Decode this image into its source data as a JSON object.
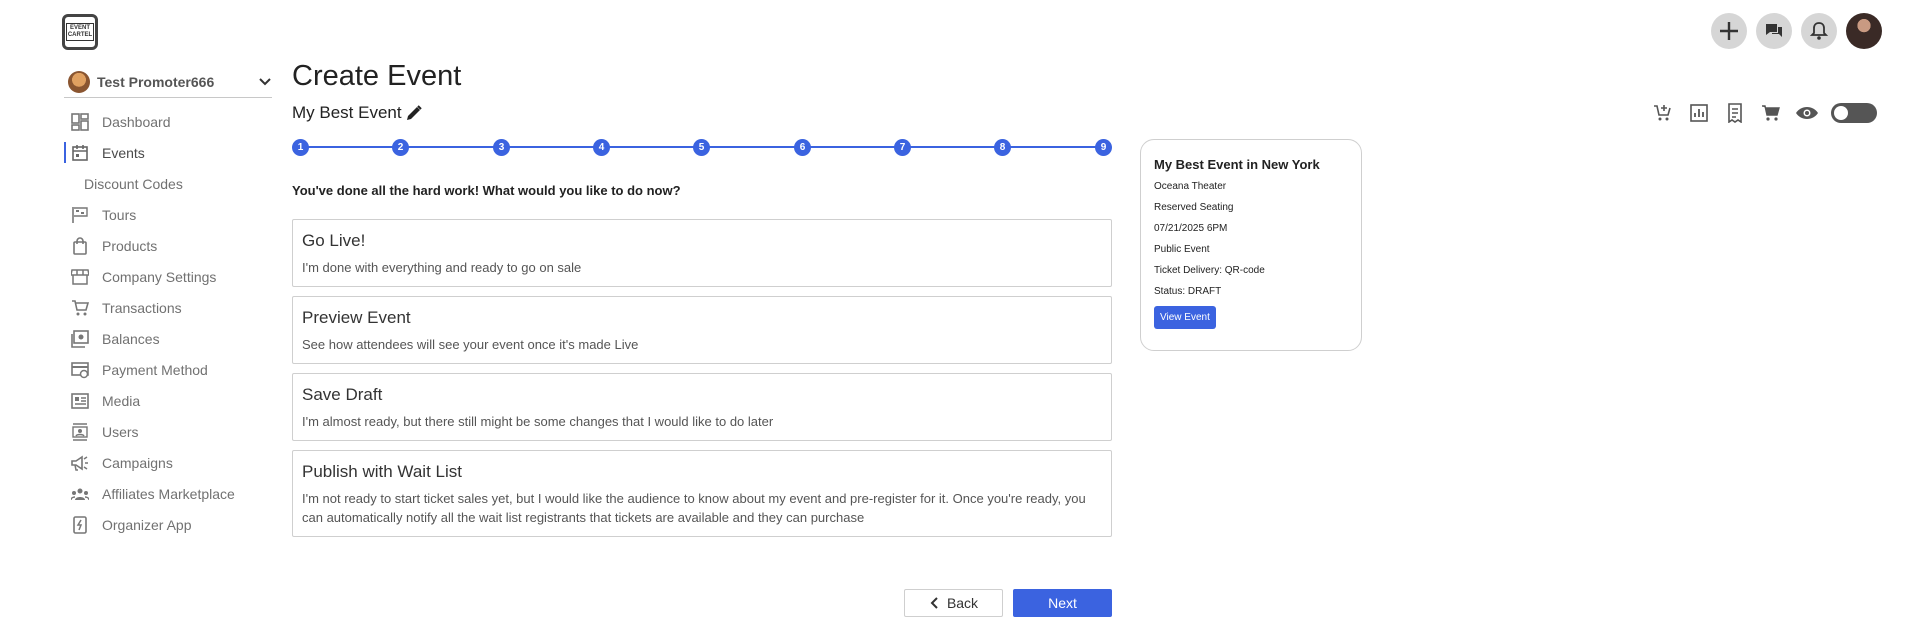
{
  "app": {
    "logo_text_1": "EVENT",
    "logo_text_2": "CARTEL"
  },
  "sidebar": {
    "promoter_name": "Test Promoter666",
    "items": [
      {
        "label": "Dashboard",
        "icon": "dashboard-icon"
      },
      {
        "label": "Events",
        "icon": "calendar-icon"
      },
      {
        "label": "Discount Codes",
        "icon": ""
      },
      {
        "label": "Tours",
        "icon": "flag-icon"
      },
      {
        "label": "Products",
        "icon": "bag-icon"
      },
      {
        "label": "Company Settings",
        "icon": "store-icon"
      },
      {
        "label": "Transactions",
        "icon": "cart-icon"
      },
      {
        "label": "Balances",
        "icon": "balance-icon"
      },
      {
        "label": "Payment Method",
        "icon": "payment-settings-icon"
      },
      {
        "label": "Media",
        "icon": "media-icon"
      },
      {
        "label": "Users",
        "icon": "users-icon"
      },
      {
        "label": "Campaigns",
        "icon": "megaphone-icon"
      },
      {
        "label": "Affiliates Marketplace",
        "icon": "group-icon"
      },
      {
        "label": "Organizer App",
        "icon": "phone-icon"
      }
    ]
  },
  "main": {
    "title": "Create Event",
    "event_name": "My Best Event",
    "steps": [
      "1",
      "2",
      "3",
      "4",
      "5",
      "6",
      "7",
      "8",
      "9"
    ],
    "question": "You've done all the hard work! What would you like to do now?",
    "options": [
      {
        "title": "Go Live!",
        "desc": "I'm done with everything and ready to go on sale"
      },
      {
        "title": "Preview Event",
        "desc": "See how attendees will see your event once it's made Live"
      },
      {
        "title": "Save Draft",
        "desc": "I'm almost ready, but there still might be some changes that I would like to do later"
      },
      {
        "title": "Publish with Wait List",
        "desc": "I'm not ready to start ticket sales yet, but I would like the audience to know about my event and pre-register for it. Once you're ready, you can automatically notify all the wait list registrants that tickets are available and they can purchase"
      }
    ],
    "back_label": "Back",
    "next_label": "Next"
  },
  "summary": {
    "title": "My Best Event in New York",
    "venue": "Oceana Theater",
    "seating": "Reserved Seating",
    "datetime": "07/21/2025 6PM",
    "visibility": "Public Event",
    "delivery": "Ticket Delivery: QR-code",
    "status": "Status: DRAFT",
    "view_label": "View Event"
  },
  "colors": {
    "accent": "#3b63e0",
    "border": "#cfcfcf"
  }
}
